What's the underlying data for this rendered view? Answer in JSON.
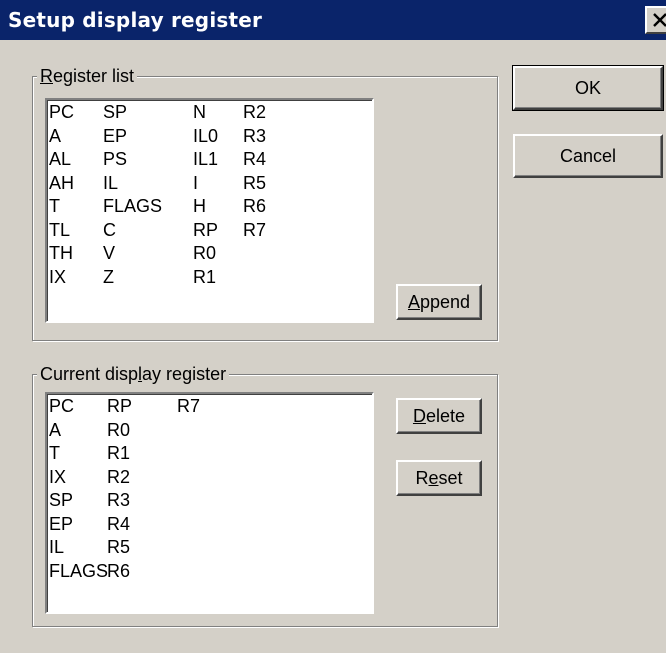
{
  "window": {
    "title": "Setup display register"
  },
  "register_list": {
    "label_mnemonic": "R",
    "label_rest": "egister list",
    "columns": [
      [
        "PC",
        "A",
        "AL",
        "AH",
        "T",
        "TL",
        "TH",
        "IX"
      ],
      [
        "SP",
        "EP",
        "PS",
        "IL",
        "FLAGS",
        "C",
        "V",
        "Z"
      ],
      [
        "N",
        "IL0",
        "IL1",
        "I",
        "H",
        "RP",
        "R0",
        "R1"
      ],
      [
        "R2",
        "R3",
        "R4",
        "R5",
        "R6",
        "R7"
      ]
    ]
  },
  "current_display": {
    "label_pre": "Current disp",
    "label_mnemonic": "l",
    "label_post": "ay register",
    "columns": [
      [
        "PC",
        "A",
        "T",
        "IX",
        "SP",
        "EP",
        "IL",
        "FLAGS"
      ],
      [
        "RP",
        "R0",
        "R1",
        "R2",
        "R3",
        "R4",
        "R5",
        "R6"
      ],
      [
        "R7"
      ]
    ]
  },
  "buttons": {
    "ok": "OK",
    "cancel": "Cancel",
    "append_mnemonic": "A",
    "append_rest": "ppend",
    "delete_mnemonic": "D",
    "delete_rest": "elete",
    "reset_pre": "R",
    "reset_mnemonic": "e",
    "reset_post": "set"
  },
  "icons": {
    "close": "close-icon"
  },
  "colors": {
    "titlebar": "#0a246a",
    "dialog": "#d4d0c8"
  }
}
